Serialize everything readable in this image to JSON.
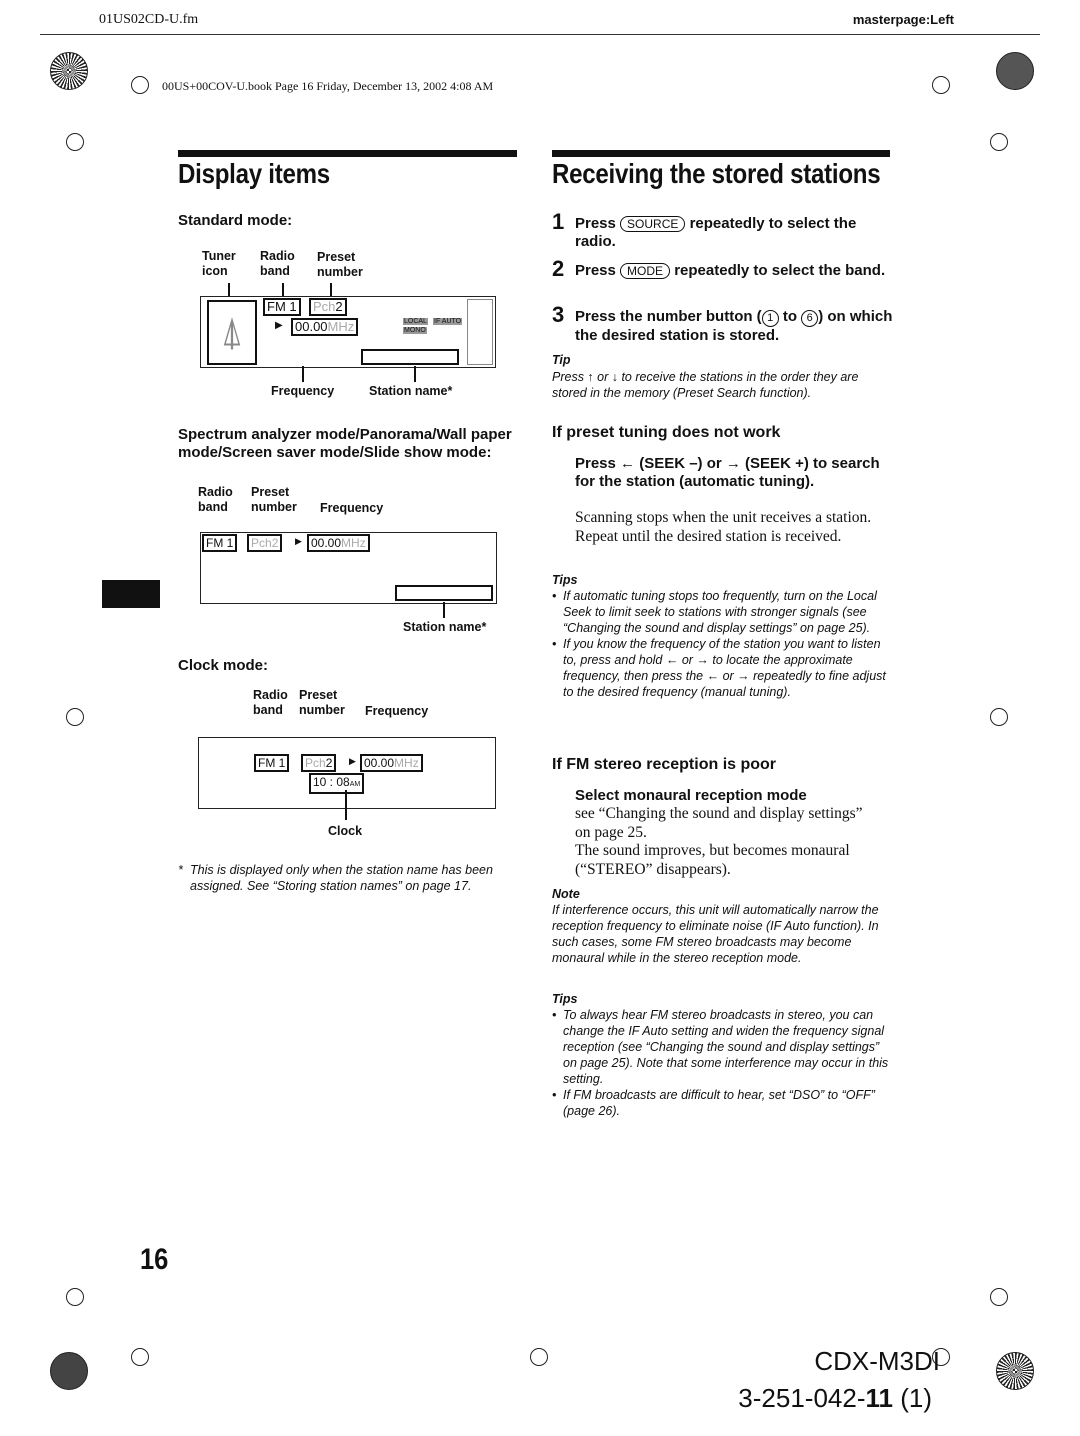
{
  "header": {
    "file": "01US02CD-U.fm",
    "masterpage": "masterpage:Left",
    "book": "00US+00COV-U.book  Page 16  Friday, December 13, 2002  4:08 AM"
  },
  "left": {
    "title": "Display items",
    "standard": {
      "heading": "Standard mode:",
      "tuner_icon": "Tuner icon",
      "radio_band": "Radio band",
      "preset_number": "Preset number",
      "band": "FM 1",
      "pch": "Pch",
      "pch_num": "2",
      "freq": "00.00",
      "mhz": "MHz",
      "local": "LOCAL",
      "ifauto": "IF AUTO",
      "mono": "MONO",
      "frequency": "Frequency",
      "station_name": "Station name*"
    },
    "spectrum": {
      "heading": "Spectrum analyzer mode/Panorama/Wall paper mode/Screen saver mode/Slide show mode:",
      "radio_band": "Radio band",
      "preset_number": "Preset number",
      "frequency": "Frequency",
      "station_name": "Station name*"
    },
    "clock": {
      "heading": "Clock mode:",
      "radio_band": "Radio band",
      "preset_number": "Preset number",
      "frequency": "Frequency",
      "time": "10 : 08",
      "am": "AM",
      "clock": "Clock"
    },
    "footnote": "This is displayed only when the station name has been assigned. See “Storing station names” on page 17.",
    "footnote_mark": "*"
  },
  "right": {
    "title": "Receiving the stored stations",
    "steps": [
      {
        "n": "1",
        "a": "Press",
        "key": "SOURCE",
        "b": "repeatedly to select the radio."
      },
      {
        "n": "2",
        "a": "Press",
        "key": "MODE",
        "b": "repeatedly to select the band."
      },
      {
        "n": "3",
        "a": "Press the number button (",
        "k1": "1",
        "to": "to",
        "k2": "6",
        "b": ") on which the desired station is stored."
      }
    ],
    "tip_label": "Tip",
    "tip": "Press ↑ or ↓ to receive the stations in the order they are stored in the memory (Preset Search function).",
    "preset_heading": "If preset tuning does not work",
    "seek_step": "Press ← (SEEK –) or → (SEEK +) to search for the station (automatic tuning).",
    "seek_body": "Scanning stops when the unit receives a station. Repeat until the desired station is received.",
    "tips1_label": "Tips",
    "tips1": [
      "If automatic tuning stops too frequently, turn on the Local Seek to limit seek to stations with stronger signals (see “Changing the sound and display settings” on page 25).",
      "If you know the frequency of the station you want to listen to, press and hold ← or → to locate the approximate frequency, then press the ← or → repeatedly to fine adjust to the desired frequency (manual tuning)."
    ],
    "fm_heading": "If FM stereo reception is poor",
    "mono_step": "Select monaural reception mode",
    "mono_body1": "see “Changing the sound and display settings” on page 25.",
    "mono_body2": "The sound improves, but becomes monaural (“STEREO” disappears).",
    "note_label": "Note",
    "note": "If interference occurs, this unit will automatically narrow the reception frequency to eliminate noise (IF Auto function). In such cases, some FM stereo broadcasts may become monaural while in the stereo reception mode.",
    "tips2_label": "Tips",
    "tips2": [
      "To always hear FM stereo broadcasts in stereo, you can change the IF Auto setting and widen the frequency signal reception (see “Changing the sound and display settings” on page 25). Note that some interference may occur in this setting.",
      "If FM broadcasts are difficult to hear, set “DSO” to “OFF” (page 26)."
    ]
  },
  "footer": {
    "page_number": "16",
    "model": "CDX-M3DI",
    "code_a": "3-251-042-",
    "code_b": "11",
    "code_c": " (1)"
  }
}
